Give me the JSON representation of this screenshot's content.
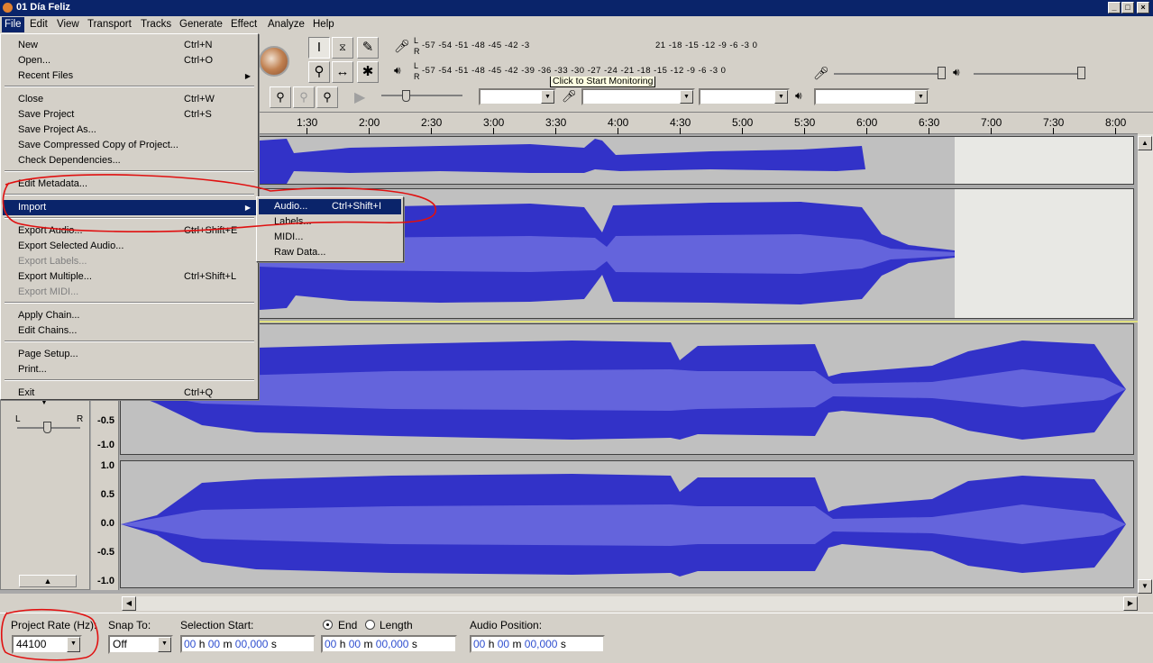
{
  "window": {
    "title": "01 Día Feliz",
    "app_icon": "audacity-icon",
    "min": "_",
    "max": "□",
    "close": "×"
  },
  "menubar": [
    "File",
    "Edit",
    "View",
    "Transport",
    "Tracks",
    "Generate",
    "Effect",
    "Analyze",
    "Help"
  ],
  "meters": {
    "record_scale": "-57 -54 -51 -48 -45 -42 -3",
    "record_scale_tail": "21 -18 -15 -12  -9  -6  -3  0",
    "play_scale": "-57 -54 -51 -48 -45 -42 -39 -36 -33 -30 -27 -24 -21 -18 -15 -12  -9  -6  -3  0",
    "tooltip": "Click to Start Monitoring",
    "L": "L",
    "R": "R"
  },
  "timeline": [
    "1:30",
    "2:00",
    "2:30",
    "3:00",
    "3:30",
    "4:00",
    "4:30",
    "5:00",
    "5:30",
    "6:00",
    "6:30",
    "7:00",
    "7:30",
    "8:00"
  ],
  "scale": {
    "pos1": "1.0",
    "zero": "0.0",
    "neg05": "-0.5",
    "neg1": "-1.0",
    "pos05": "0.5"
  },
  "track_controls": {
    "L": "L",
    "R": "R"
  },
  "file_menu": {
    "items": [
      {
        "label": "New",
        "shortcut": "Ctrl+N"
      },
      {
        "label": "Open...",
        "shortcut": "Ctrl+O"
      },
      {
        "label": "Recent Files",
        "shortcut": ""
      },
      {
        "label": "Close",
        "shortcut": "Ctrl+W"
      },
      {
        "label": "Save Project",
        "shortcut": "Ctrl+S"
      },
      {
        "label": "Save Project As...",
        "shortcut": ""
      },
      {
        "label": "Save Compressed Copy of Project...",
        "shortcut": ""
      },
      {
        "label": "Check Dependencies...",
        "shortcut": ""
      },
      {
        "label": "Edit Metadata...",
        "shortcut": ""
      },
      {
        "label": "Import",
        "shortcut": ""
      },
      {
        "label": "Export Audio...",
        "shortcut": "Ctrl+Shift+E"
      },
      {
        "label": "Export Selected Audio...",
        "shortcut": ""
      },
      {
        "label": "Export Labels...",
        "shortcut": ""
      },
      {
        "label": "Export Multiple...",
        "shortcut": "Ctrl+Shift+L"
      },
      {
        "label": "Export MIDI...",
        "shortcut": ""
      },
      {
        "label": "Apply Chain...",
        "shortcut": ""
      },
      {
        "label": "Edit Chains...",
        "shortcut": ""
      },
      {
        "label": "Page Setup...",
        "shortcut": ""
      },
      {
        "label": "Print...",
        "shortcut": ""
      },
      {
        "label": "Exit",
        "shortcut": "Ctrl+Q"
      }
    ]
  },
  "import_submenu": [
    {
      "label": "Audio...",
      "shortcut": "Ctrl+Shift+I"
    },
    {
      "label": "Labels...",
      "shortcut": ""
    },
    {
      "label": "MIDI...",
      "shortcut": ""
    },
    {
      "label": "Raw Data...",
      "shortcut": ""
    }
  ],
  "selection_bar": {
    "project_rate_label": "Project Rate (Hz):",
    "project_rate_value": "44100",
    "snap_label": "Snap To:",
    "snap_value": "Off",
    "sel_start_label": "Selection Start:",
    "end_label": "End",
    "length_label": "Length",
    "audio_pos_label": "Audio Position:",
    "time_hh": "00",
    "time_h": "h",
    "time_mm": "00",
    "time_m": "m",
    "time_ss": "00,000",
    "time_s": "s"
  },
  "colors": {
    "waveform": "#3232c8",
    "rms": "#6464dc",
    "annotation": "#e01010",
    "menu_highlight": "#0a246a"
  }
}
